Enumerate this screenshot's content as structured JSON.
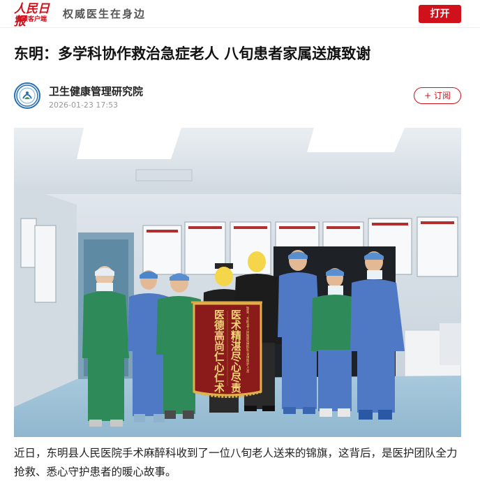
{
  "header": {
    "brand_name": "人民日报",
    "brand_sub": "健康客户端",
    "slogan": "权威医生在身边",
    "open_label": "打开"
  },
  "article": {
    "title": "东明：多学科协作救治急症老人 八旬患者家属送旗致谢",
    "author": {
      "name": "卫生健康管理研究院",
      "time": "2026-01-23 17:53",
      "subscribe_label": "+ 订阅"
    },
    "photo": {
      "banner_right_column": "医术精湛尽心尽责",
      "banner_left_column": "医德高尚仁心仁术",
      "banner_small_header": "致谢：东明县人民医院麻醉科全体医护人员"
    },
    "body": "近日，东明县人民医院手术麻醉科收到了一位八旬老人送来的锦旗，这背后，是医护团队全力抢救、悉心守护患者的暖心故事。"
  },
  "colors": {
    "brand_red": "#d0111b",
    "scrub_green": "#2e8b57",
    "scrub_blue": "#4a7cc9",
    "banner_red": "#8b1a1a",
    "banner_gold": "#e0b04a"
  }
}
